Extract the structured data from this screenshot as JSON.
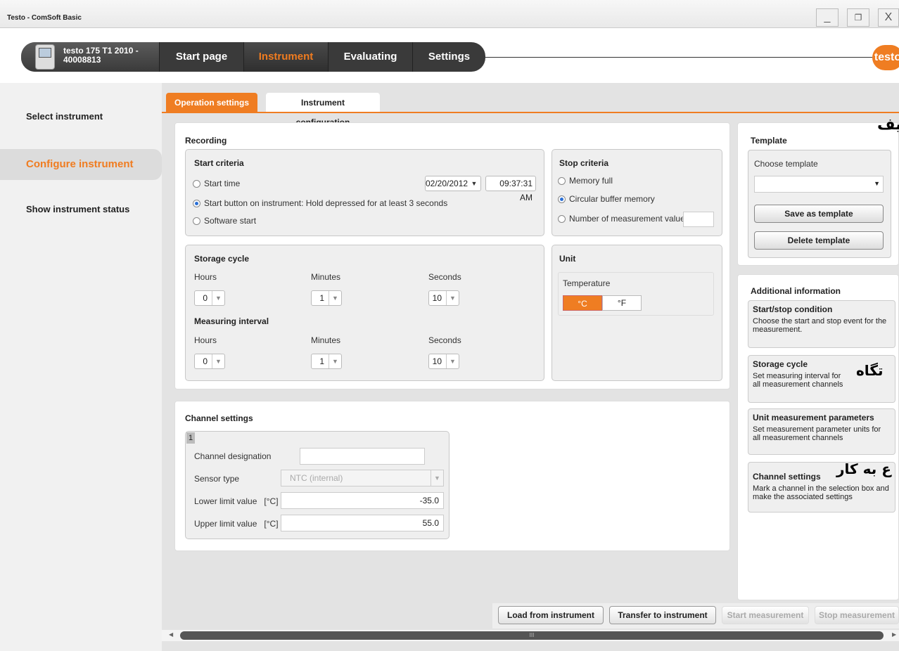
{
  "window": {
    "title": "Testo - ComSoft Basic",
    "min": "_",
    "max": "❐",
    "close": "X"
  },
  "nav": {
    "device_name": "testo 175 T1 2010 -",
    "device_serial": "40008813",
    "tabs": [
      "Start page",
      "Instrument",
      "Evaluating",
      "Settings"
    ],
    "logo": "testo"
  },
  "sidebar": {
    "items": [
      "Select instrument",
      "Configure instrument",
      "Show instrument status"
    ]
  },
  "tabs": [
    "Operation settings",
    "Instrument configuration"
  ],
  "recording": {
    "title": "Recording",
    "start": {
      "title": "Start criteria",
      "opt1": "Start time",
      "date": "02/20/2012",
      "time": "09:37:31 AM",
      "opt2": "Start button on instrument: Hold depressed for at least 3 seconds",
      "opt3": "Software start"
    },
    "stop": {
      "title": "Stop criteria",
      "opt1": "Memory full",
      "opt2": "Circular buffer memory",
      "opt3": "Number of measurement values"
    },
    "storage": {
      "title": "Storage cycle",
      "hours": "Hours",
      "minutes": "Minutes",
      "seconds": "Seconds",
      "h": "0",
      "m": "1",
      "s": "10"
    },
    "measuring": {
      "title": "Measuring interval",
      "hours": "Hours",
      "minutes": "Minutes",
      "seconds": "Seconds",
      "h": "0",
      "m": "1",
      "s": "10"
    },
    "unit": {
      "title": "Unit",
      "temp": "Temperature",
      "c": "°C",
      "f": "°F"
    }
  },
  "channel": {
    "title": "Channel settings",
    "num": "1",
    "designation": "Channel designation",
    "sensor": "Sensor type",
    "sensor_val": "NTC (internal)",
    "lower": "Lower limit value",
    "lower_unit": "[°C]",
    "lower_val": "-35.0",
    "upper": "Upper limit value",
    "upper_unit": "[°C]",
    "upper_val": "55.0"
  },
  "template": {
    "title": "Template",
    "choose": "Choose template",
    "save": "Save as template",
    "delete": "Delete template",
    "overlay": "یف"
  },
  "additional": {
    "title": "Additional information",
    "items": [
      {
        "t": "Start/stop condition",
        "d": "Choose the start and stop event for the measurement."
      },
      {
        "t": "Storage cycle",
        "d": "Set measuring interval for all measurement channels"
      },
      {
        "t": "Unit measurement parameters",
        "d": "Set measurement parameter units for all measurement channels"
      },
      {
        "t": "Channel settings",
        "d": "Mark a channel in the selection box and make the associated settings"
      }
    ],
    "overlay1": "تگاه",
    "overlay2": "ع به کار"
  },
  "bottom": {
    "load": "Load from instrument",
    "transfer": "Transfer to instrument",
    "start": "Start measurement",
    "stop": "Stop measurement",
    "scroll": "III"
  }
}
